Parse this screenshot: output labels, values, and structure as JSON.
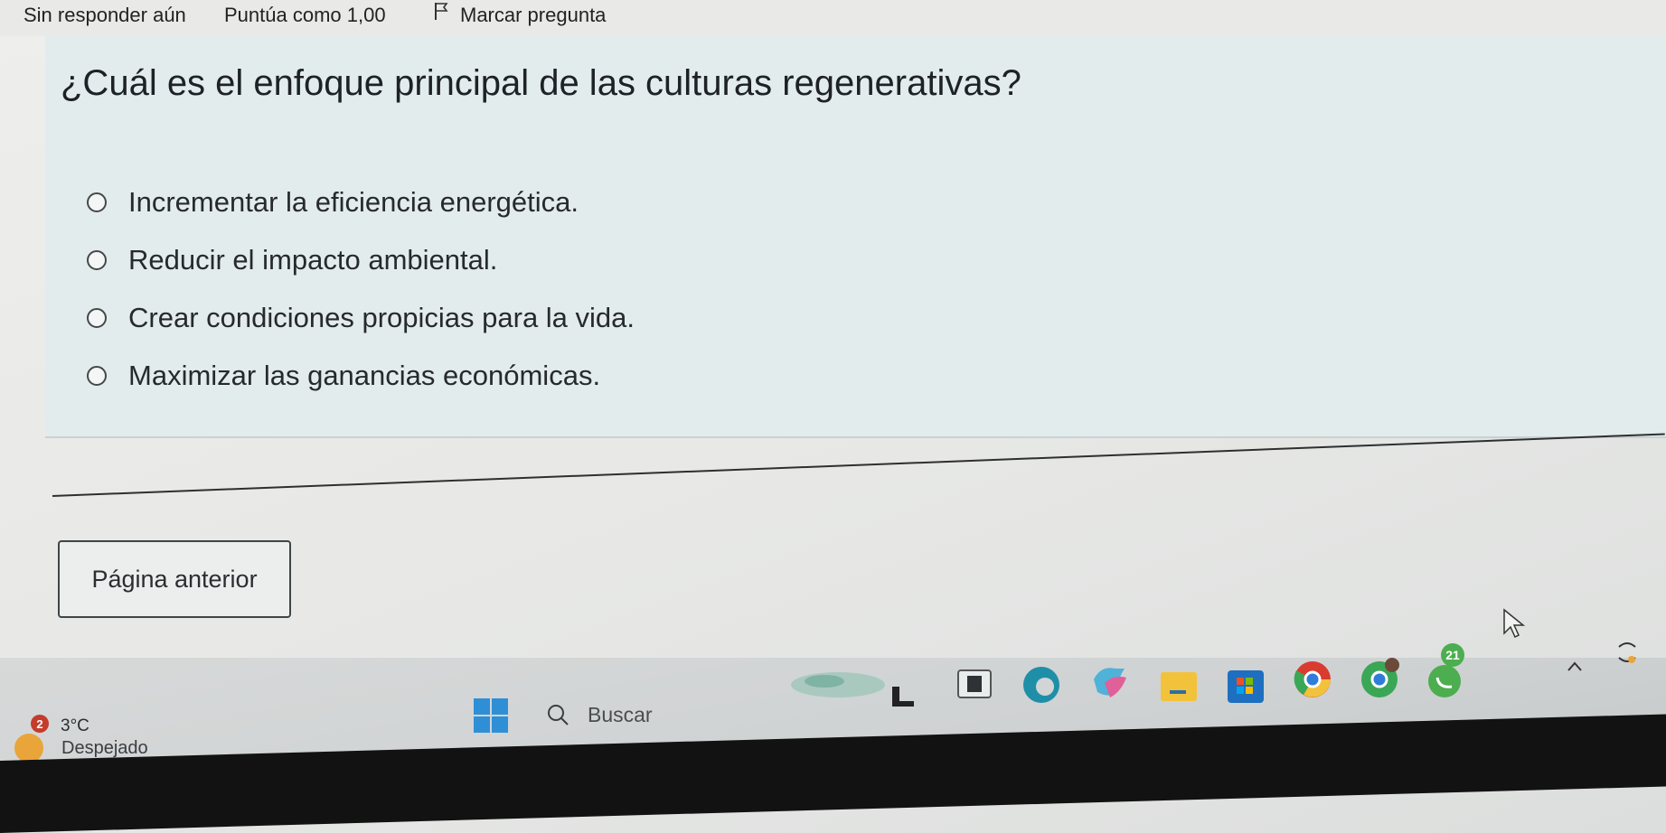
{
  "info_bar": {
    "status": "Sin responder aún",
    "score": "Puntúa como 1,00",
    "flag_label": "Marcar pregunta"
  },
  "question": {
    "text": "¿Cuál es el enfoque principal de las culturas regenerativas?",
    "options": [
      "Incrementar la eficiencia energética.",
      "Reducir el impacto ambiental.",
      "Crear condiciones propicias para la vida.",
      "Maximizar las ganancias económicas."
    ]
  },
  "navigation": {
    "prev_label": "Página anterior"
  },
  "taskbar": {
    "weather_badge": "2",
    "temperature": "3°C",
    "weather_description": "Despejado",
    "search_placeholder": "Buscar",
    "app_badge": "21",
    "icons": [
      "start-icon",
      "search-icon",
      "widgets-icon",
      "task-view-icon",
      "terminal-icon",
      "edge-icon",
      "copilot-icon",
      "file-explorer-icon",
      "store-icon",
      "chrome-icon",
      "chrome-profile-icon",
      "whatsapp-icon",
      "tray-chevron-icon"
    ]
  },
  "colors": {
    "question_background": "#e3ecec",
    "page_background": "#eeeeec",
    "taskbar": "#d2d5d6",
    "radio_border": "#44484b",
    "badge": "#c43c2c",
    "whatsapp": "#4cae4f",
    "edge": "#1f8fa8"
  }
}
